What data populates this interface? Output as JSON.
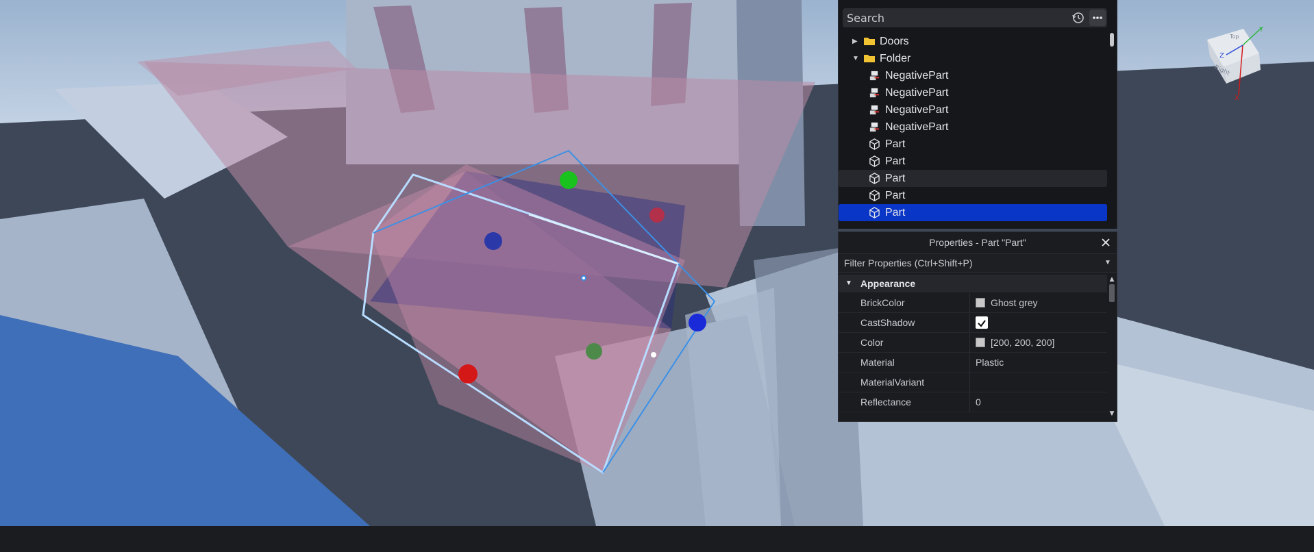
{
  "explorer": {
    "search_placeholder": "Search",
    "tree": [
      {
        "label": "Doors",
        "type": "folder",
        "expanded": false,
        "selected": false,
        "hovered": false
      },
      {
        "label": "Folder",
        "type": "folder",
        "expanded": true,
        "selected": false,
        "hovered": false
      },
      {
        "label": "NegativePart",
        "type": "negative-part",
        "selected": false,
        "hovered": false
      },
      {
        "label": "NegativePart",
        "type": "negative-part",
        "selected": false,
        "hovered": false
      },
      {
        "label": "NegativePart",
        "type": "negative-part",
        "selected": false,
        "hovered": false
      },
      {
        "label": "NegativePart",
        "type": "negative-part",
        "selected": false,
        "hovered": false
      },
      {
        "label": "Part",
        "type": "part",
        "selected": false,
        "hovered": false
      },
      {
        "label": "Part",
        "type": "part",
        "selected": false,
        "hovered": false
      },
      {
        "label": "Part",
        "type": "part",
        "selected": false,
        "hovered": true
      },
      {
        "label": "Part",
        "type": "part",
        "selected": false,
        "hovered": false
      },
      {
        "label": "Part",
        "type": "part",
        "selected": true,
        "hovered": false
      }
    ]
  },
  "properties": {
    "title": "Properties - Part \"Part\"",
    "filter_placeholder": "Filter Properties (Ctrl+Shift+P)",
    "section": "Appearance",
    "rows": [
      {
        "name": "BrickColor",
        "value": "Ghost grey",
        "swatch": "#c8c8c8"
      },
      {
        "name": "CastShadow",
        "checked": true
      },
      {
        "name": "Color",
        "value": "[200, 200, 200]",
        "swatch": "#c8c8c8"
      },
      {
        "name": "Material",
        "value": "Plastic"
      },
      {
        "name": "MaterialVariant",
        "value": ""
      },
      {
        "name": "Reflectance",
        "value": "0"
      }
    ]
  },
  "viewcube": {
    "faces": [
      "Top",
      "Right"
    ],
    "axes": [
      "Y",
      "Z",
      "X"
    ]
  },
  "colors": {
    "selection": "#0a36c8",
    "panel_bg": "#1b1c20",
    "handle_red": "#d41818",
    "handle_green": "#19c21c",
    "handle_blue": "#1a2ad8"
  }
}
